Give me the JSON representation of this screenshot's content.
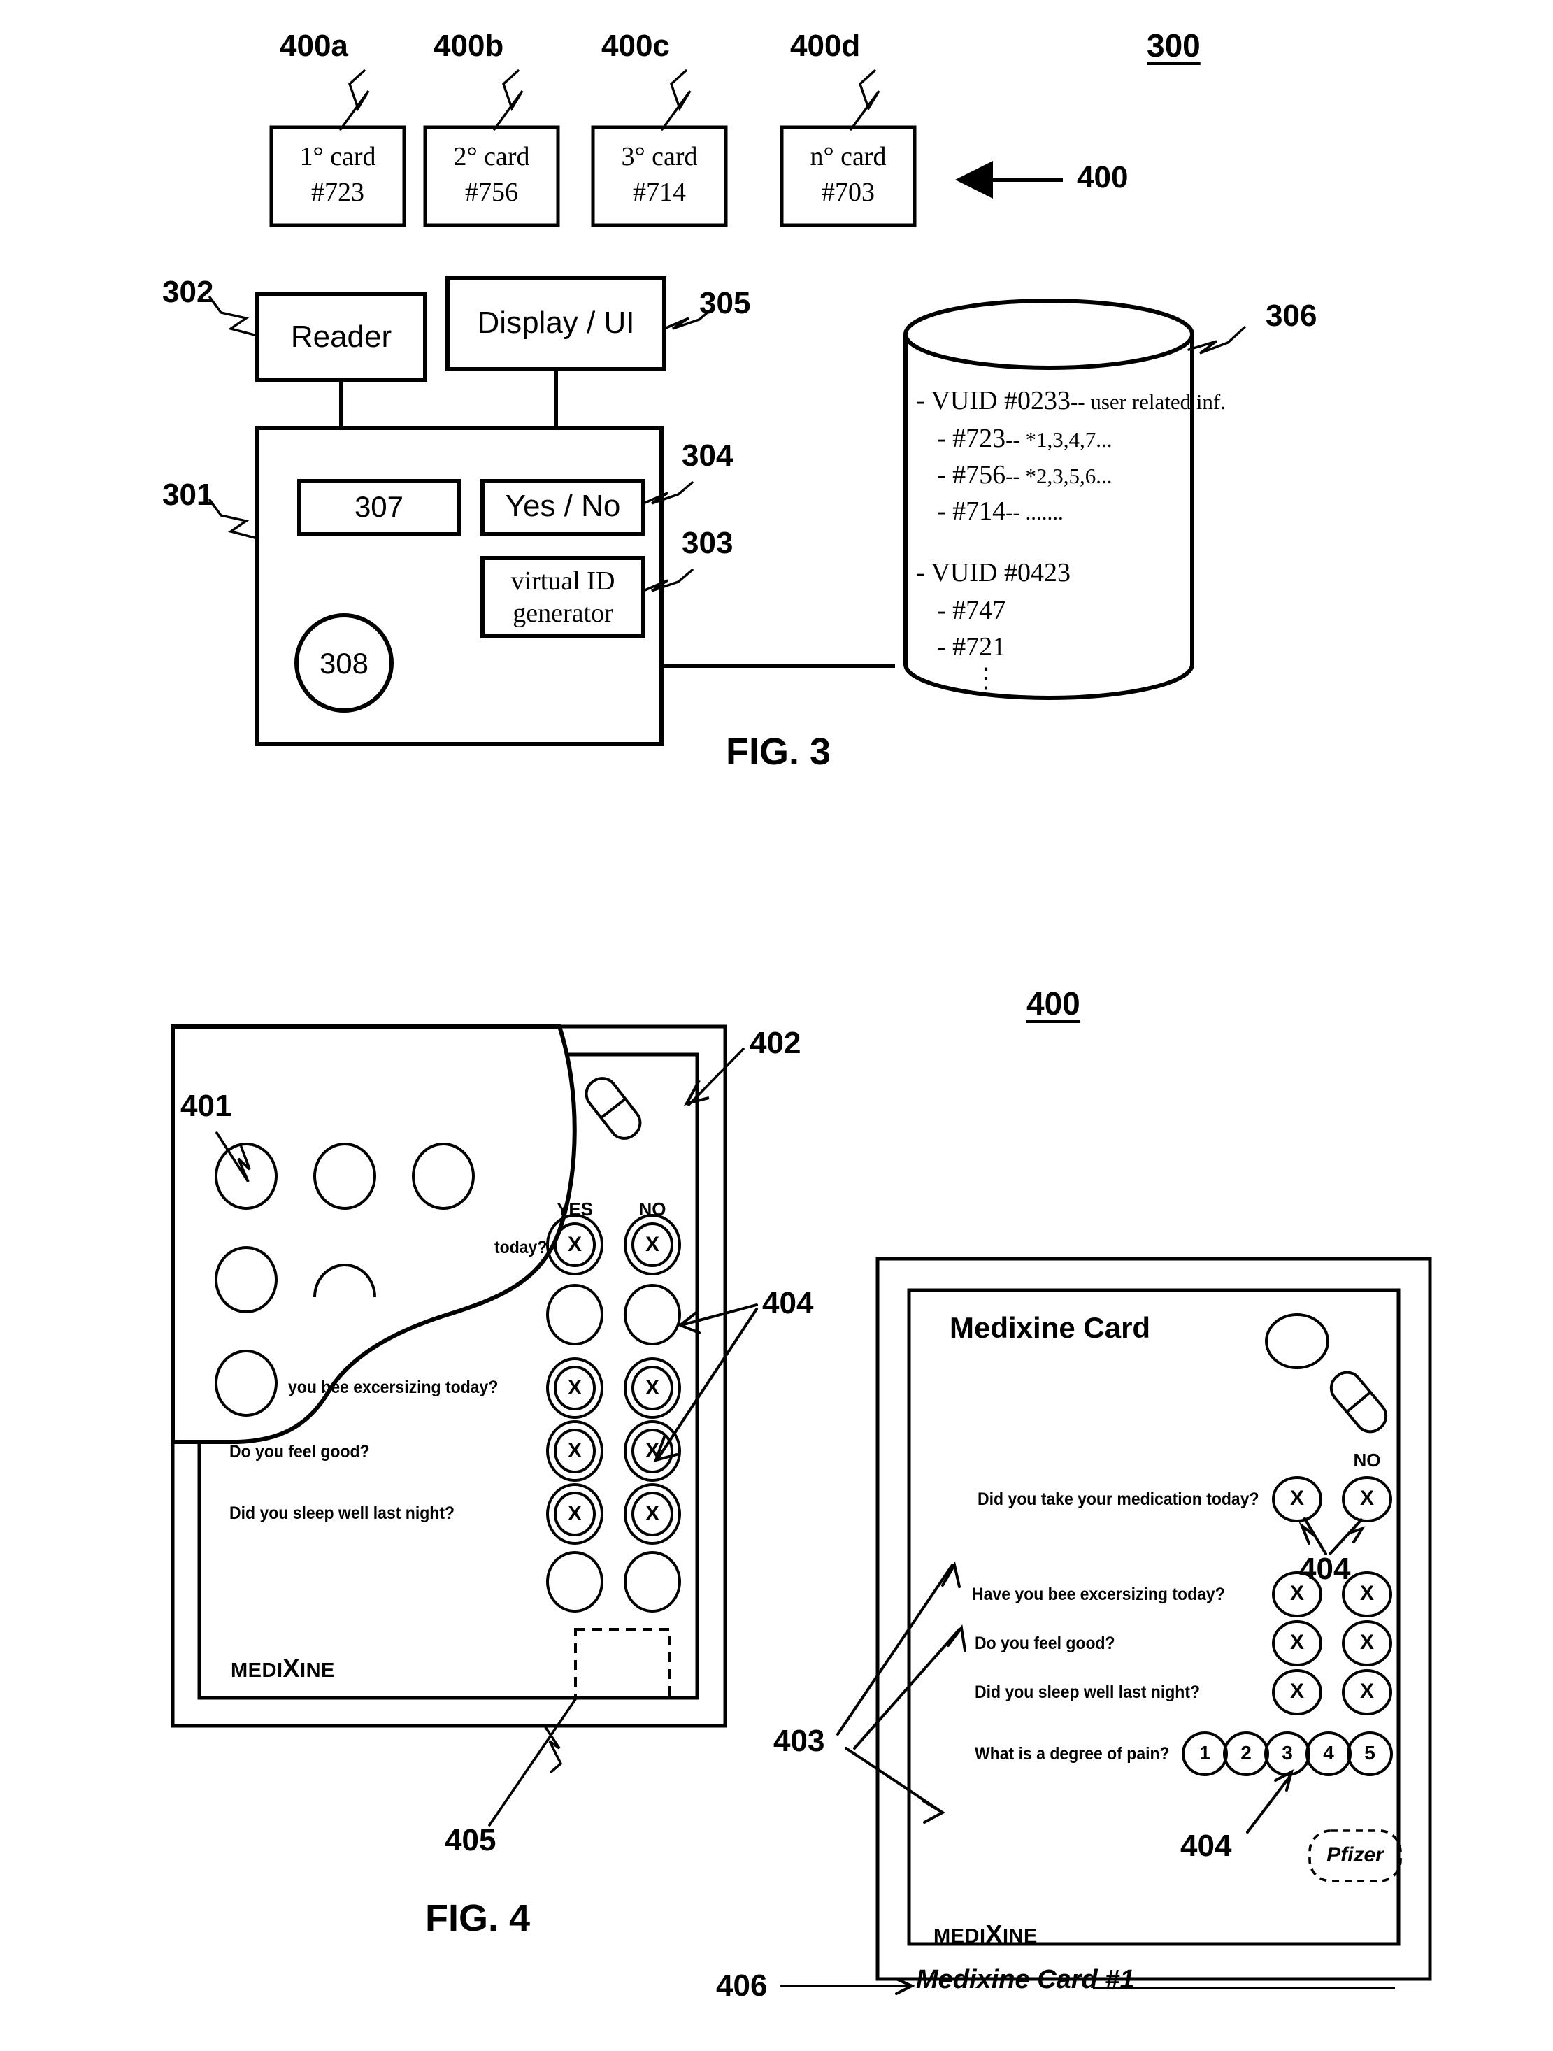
{
  "figure3": {
    "figure_number": "300",
    "caption": "FIG. 3",
    "cards_group_label": "400",
    "cards": [
      {
        "ref": "400a",
        "line1": "1° card",
        "line2": "#723"
      },
      {
        "ref": "400b",
        "line1": "2° card",
        "line2": "#756"
      },
      {
        "ref": "400c",
        "line1": "3° card",
        "line2": "#714"
      },
      {
        "ref": "400d",
        "line1": "n° card",
        "line2": "#703"
      }
    ],
    "blocks": {
      "reader": {
        "ref": "302",
        "label": "Reader"
      },
      "display": {
        "ref": "305",
        "label": "Display / UI"
      },
      "device": {
        "ref": "301"
      },
      "inner_307": {
        "label": "307"
      },
      "yes_no": {
        "ref": "304",
        "label": "Yes / No"
      },
      "vid_generator": {
        "ref": "303",
        "line1": "virtual ID",
        "line2": "generator"
      },
      "circle_308": {
        "label": "308"
      }
    },
    "database": {
      "ref": "306",
      "entries": [
        "- VUID #0233",
        "-- user related inf.",
        "- #723",
        "-- *1,3,4,7...",
        "- #756",
        "-- *2,3,5,6...",
        "- #714",
        "-- .......",
        "- VUID #0423",
        "- #747",
        "- #721"
      ],
      "line1_main": "- VUID #0233",
      "line1_tail": "-- user related inf.",
      "line2_main": "- #723",
      "line2_tail": "-- *1,3,4,7...",
      "line3_main": "- #756",
      "line3_tail": "-- *2,3,5,6...",
      "line4_main": "- #714",
      "line4_tail": "-- .......",
      "line5_main": "- VUID #0423",
      "line6_main": "- #747",
      "line7_main": "- #721",
      "ellipsis": "⋮"
    }
  },
  "figure4": {
    "figure_number": "400",
    "caption": "FIG. 4",
    "left_card": {
      "refs": {
        "blister_cavity": "401",
        "card_body": "402",
        "answer_button": "404",
        "chip_area": "405"
      },
      "yes_label": "YES",
      "no_label": "NO",
      "questions": [
        "today?",
        "you bee excersizing today?",
        "Do you feel good?",
        "Did you sleep well last night?"
      ],
      "brand_pre": "MEDI",
      "brand_big": "X",
      "brand_post": "INE",
      "x_glyph": "X"
    },
    "right_card": {
      "refs": {
        "questions": "403",
        "answer_button_top": "404",
        "answer_button_bottom": "404",
        "card_id": "406"
      },
      "title": "Medixine Card",
      "no_label": "NO",
      "questions": [
        "Did you take your medication today?",
        "Have you bee excersizing today?",
        "Do you feel good?",
        "Did you sleep well last night?",
        "What is a degree of pain?"
      ],
      "pain_scale": [
        "1",
        "2",
        "3",
        "4",
        "5"
      ],
      "brand_pre": "MEDI",
      "brand_big": "X",
      "brand_post": "INE",
      "card_id": "Medixine Card #1",
      "sponsor": "Pfizer",
      "x_glyph": "X"
    }
  }
}
